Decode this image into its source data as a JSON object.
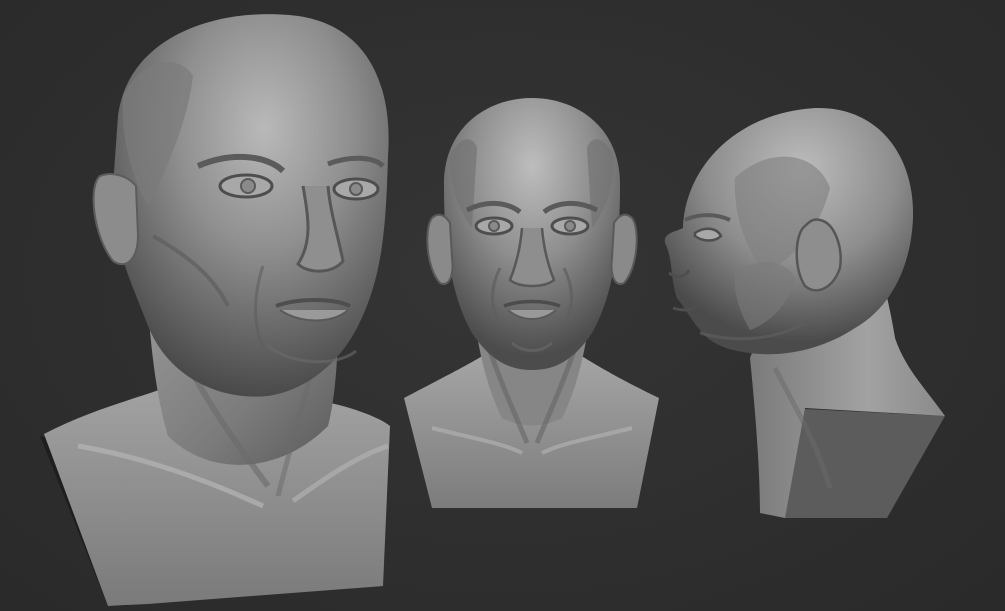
{
  "scene": {
    "background_color": "#2f2f2f",
    "material_color": "#8a8a8a",
    "views": [
      {
        "id": "three-quarter",
        "description_icon": "sculpted-bust-three-quarter-view"
      },
      {
        "id": "front",
        "description_icon": "sculpted-bust-front-view"
      },
      {
        "id": "profile",
        "description_icon": "sculpted-bust-profile-view"
      }
    ]
  }
}
